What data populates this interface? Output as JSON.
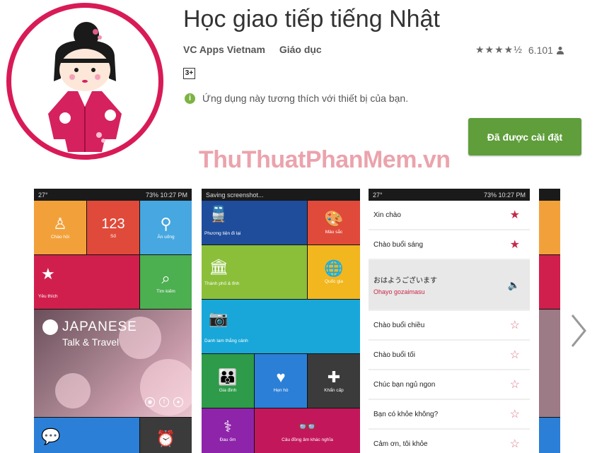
{
  "app": {
    "title": "Học giao tiếp tiếng Nhật",
    "developer": "VC Apps Vietnam",
    "category": "Giáo dục",
    "rating_stars": "★★★★½",
    "rating_count": "6.101",
    "age_rating": "3+",
    "compat_text": "Ứng dụng này tương thích với thiết bị của bạn.",
    "install_label": "Đã được cài đặt",
    "accent_color": "#5f9e3b",
    "icon_ring_color": "#d81b57"
  },
  "watermark": "ThuThuatPhanMem.vn",
  "screenshot1": {
    "status_left": "27°",
    "status_right": "73% 10:27 PM",
    "tiles": [
      {
        "label": "Chào hỏi",
        "icon": "greeting-icon"
      },
      {
        "label": "123",
        "sub": "Số",
        "icon": "number-icon"
      },
      {
        "label": "Ăn uống",
        "icon": "dining-icon"
      },
      {
        "label": "Yêu thích",
        "icon": "star-icon"
      },
      {
        "label": "Tìm kiếm",
        "icon": "search-icon"
      }
    ],
    "japanese_title": "JAPANESE",
    "japanese_subtitle": "Talk & Travel"
  },
  "screenshot2": {
    "status_left": "Saving screenshot...",
    "tiles": [
      {
        "label": "Phương tiện đi lại"
      },
      {
        "label": "Màu sắc"
      },
      {
        "label": "Thành phố & tỉnh"
      },
      {
        "label": "Quốc gia"
      },
      {
        "label": "Danh lam thắng cảnh"
      },
      {
        "label": "Gia đình"
      },
      {
        "label": "Hẹn hò"
      },
      {
        "label": "Khẩn cấp"
      },
      {
        "label": "Đau ốm"
      },
      {
        "label": "Câu đồng âm khác nghĩa"
      }
    ]
  },
  "screenshot3": {
    "status_left": "27°",
    "status_right": "73% 10:27 PM",
    "items": [
      {
        "text": "Xin chào",
        "starred": true
      },
      {
        "text": "Chào buổi sáng",
        "starred": true
      },
      {
        "text": "おはようございます",
        "romaji": "Ohayo gozaimasu",
        "expanded": true
      },
      {
        "text": "Chào buổi chiều",
        "starred": false
      },
      {
        "text": "Chào buổi tối",
        "starred": false
      },
      {
        "text": "Chúc bạn ngủ ngon",
        "starred": false
      },
      {
        "text": "Bạn có khỏe không?",
        "starred": false
      },
      {
        "text": "Cảm ơn, tôi khỏe",
        "starred": false
      }
    ]
  }
}
